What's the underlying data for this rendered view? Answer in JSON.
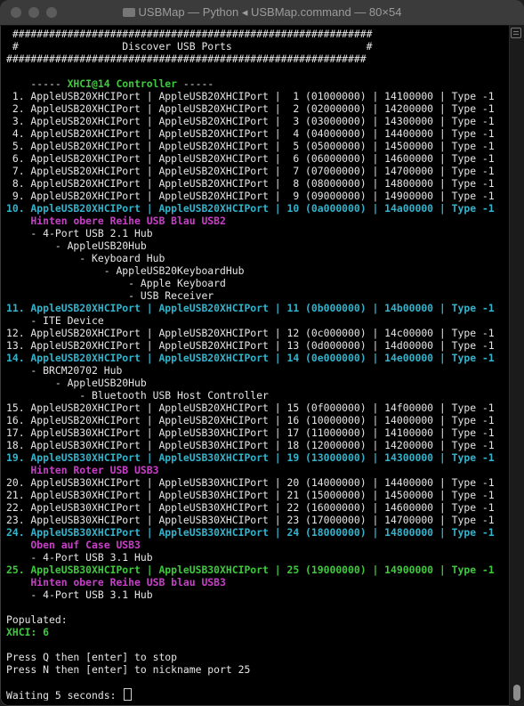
{
  "window": {
    "title": "USBMap — Python ◂ USBMap.command — 80×54"
  },
  "colors": {
    "background": "#000000",
    "text": "#e6e6e6",
    "cyan": "#33b3cc",
    "green": "#3ec93e",
    "magenta": "#c93fc9"
  },
  "terminal": {
    "lines": [
      {
        "t": " ###########################################################",
        "c": ""
      },
      {
        "t": " #                 Discover USB Ports                      #",
        "c": ""
      },
      {
        "t": "###########################################################",
        "c": ""
      },
      {
        "t": "",
        "c": ""
      },
      {
        "t": "    ----- XHCI@14 Controller -----",
        "c": "green-title"
      },
      {
        "t": " 1. AppleUSB20XHCIPort | AppleUSB20XHCIPort |  1 (01000000) | 14100000 | Type -1",
        "c": ""
      },
      {
        "t": " 2. AppleUSB20XHCIPort | AppleUSB20XHCIPort |  2 (02000000) | 14200000 | Type -1",
        "c": ""
      },
      {
        "t": " 3. AppleUSB20XHCIPort | AppleUSB20XHCIPort |  3 (03000000) | 14300000 | Type -1",
        "c": ""
      },
      {
        "t": " 4. AppleUSB20XHCIPort | AppleUSB20XHCIPort |  4 (04000000) | 14400000 | Type -1",
        "c": ""
      },
      {
        "t": " 5. AppleUSB20XHCIPort | AppleUSB20XHCIPort |  5 (05000000) | 14500000 | Type -1",
        "c": ""
      },
      {
        "t": " 6. AppleUSB20XHCIPort | AppleUSB20XHCIPort |  6 (06000000) | 14600000 | Type -1",
        "c": ""
      },
      {
        "t": " 7. AppleUSB20XHCIPort | AppleUSB20XHCIPort |  7 (07000000) | 14700000 | Type -1",
        "c": ""
      },
      {
        "t": " 8. AppleUSB20XHCIPort | AppleUSB20XHCIPort |  8 (08000000) | 14800000 | Type -1",
        "c": ""
      },
      {
        "t": " 9. AppleUSB20XHCIPort | AppleUSB20XHCIPort |  9 (09000000) | 14900000 | Type -1",
        "c": ""
      },
      {
        "t": "10. AppleUSB20XHCIPort | AppleUSB20XHCIPort | 10 (0a000000) | 14a00000 | Type -1",
        "c": "cyan"
      },
      {
        "t": "    Hinten obere Reihe USB Blau USB2",
        "c": "magenta"
      },
      {
        "t": "    - 4-Port USB 2.1 Hub",
        "c": ""
      },
      {
        "t": "        - AppleUSB20Hub",
        "c": ""
      },
      {
        "t": "            - Keyboard Hub",
        "c": ""
      },
      {
        "t": "                - AppleUSB20KeyboardHub",
        "c": ""
      },
      {
        "t": "                    - Apple Keyboard",
        "c": ""
      },
      {
        "t": "                    - USB Receiver",
        "c": ""
      },
      {
        "t": "11. AppleUSB20XHCIPort | AppleUSB20XHCIPort | 11 (0b000000) | 14b00000 | Type -1",
        "c": "cyan"
      },
      {
        "t": "    - ITE Device",
        "c": ""
      },
      {
        "t": "12. AppleUSB20XHCIPort | AppleUSB20XHCIPort | 12 (0c000000) | 14c00000 | Type -1",
        "c": ""
      },
      {
        "t": "13. AppleUSB20XHCIPort | AppleUSB20XHCIPort | 13 (0d000000) | 14d00000 | Type -1",
        "c": ""
      },
      {
        "t": "14. AppleUSB20XHCIPort | AppleUSB20XHCIPort | 14 (0e000000) | 14e00000 | Type -1",
        "c": "cyan"
      },
      {
        "t": "    - BRCM20702 Hub",
        "c": ""
      },
      {
        "t": "        - AppleUSB20Hub",
        "c": ""
      },
      {
        "t": "            - Bluetooth USB Host Controller",
        "c": ""
      },
      {
        "t": "15. AppleUSB20XHCIPort | AppleUSB20XHCIPort | 15 (0f000000) | 14f00000 | Type -1",
        "c": ""
      },
      {
        "t": "16. AppleUSB20XHCIPort | AppleUSB20XHCIPort | 16 (10000000) | 14000000 | Type -1",
        "c": ""
      },
      {
        "t": "17. AppleUSB30XHCIPort | AppleUSB30XHCIPort | 17 (11000000) | 14100000 | Type -1",
        "c": ""
      },
      {
        "t": "18. AppleUSB30XHCIPort | AppleUSB30XHCIPort | 18 (12000000) | 14200000 | Type -1",
        "c": ""
      },
      {
        "t": "19. AppleUSB30XHCIPort | AppleUSB30XHCIPort | 19 (13000000) | 14300000 | Type -1",
        "c": "cyan"
      },
      {
        "t": "    Hinten Roter USB USB3",
        "c": "magenta"
      },
      {
        "t": "20. AppleUSB30XHCIPort | AppleUSB30XHCIPort | 20 (14000000) | 14400000 | Type -1",
        "c": ""
      },
      {
        "t": "21. AppleUSB30XHCIPort | AppleUSB30XHCIPort | 21 (15000000) | 14500000 | Type -1",
        "c": ""
      },
      {
        "t": "22. AppleUSB30XHCIPort | AppleUSB30XHCIPort | 22 (16000000) | 14600000 | Type -1",
        "c": ""
      },
      {
        "t": "23. AppleUSB30XHCIPort | AppleUSB30XHCIPort | 23 (17000000) | 14700000 | Type -1",
        "c": ""
      },
      {
        "t": "24. AppleUSB30XHCIPort | AppleUSB30XHCIPort | 24 (18000000) | 14800000 | Type -1",
        "c": "cyan"
      },
      {
        "t": "    Oben auf Case USB3",
        "c": "magenta"
      },
      {
        "t": "    - 4-Port USB 3.1 Hub",
        "c": ""
      },
      {
        "t": "25. AppleUSB30XHCIPort | AppleUSB30XHCIPort | 25 (19000000) | 14900000 | Type -1",
        "c": "green"
      },
      {
        "t": "    Hinten obere Reihe USB blau USB3",
        "c": "magenta"
      },
      {
        "t": "    - 4-Port USB 3.1 Hub",
        "c": ""
      },
      {
        "t": "",
        "c": ""
      },
      {
        "t": "Populated:",
        "c": ""
      },
      {
        "t": "XHCI: 6",
        "c": "green"
      },
      {
        "t": "",
        "c": ""
      },
      {
        "t": "Press Q then [enter] to stop",
        "c": ""
      },
      {
        "t": "Press N then [enter] to nickname port 25",
        "c": ""
      },
      {
        "t": "",
        "c": ""
      },
      {
        "t": "Waiting 5 seconds: ",
        "c": "prompt"
      }
    ]
  }
}
